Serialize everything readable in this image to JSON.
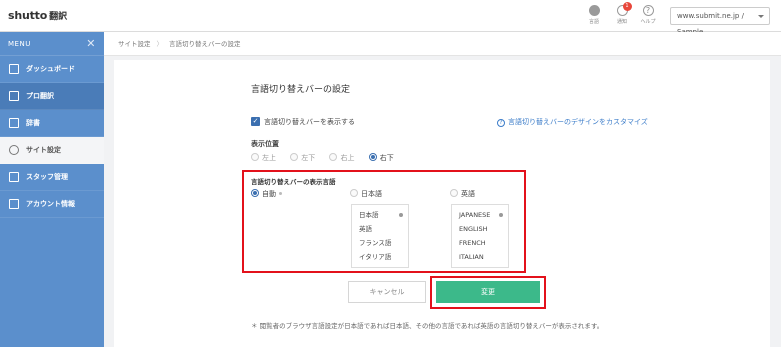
{
  "header": {
    "logo_brand": "shutto",
    "logo_sub": "翻訳",
    "icons": [
      {
        "name": "globe-icon",
        "label": "言語"
      },
      {
        "name": "bell-icon",
        "label": "通知",
        "badge": "1"
      },
      {
        "name": "help-icon",
        "label": "ヘルプ",
        "glyph": "?"
      }
    ],
    "site_select": "www.submit.ne.jp / Sample"
  },
  "sidebar": {
    "menu_label": "MENU",
    "close_glyph": "✕",
    "items": [
      {
        "label": "ダッシュボード",
        "icon": "home-icon"
      },
      {
        "label": "プロ翻訳",
        "icon": "grid-icon"
      },
      {
        "label": "辞書",
        "icon": "book-icon"
      },
      {
        "label": "サイト設定",
        "icon": "gear-icon"
      },
      {
        "label": "スタッフ管理",
        "icon": "users-icon"
      },
      {
        "label": "アカウント情報",
        "icon": "document-icon"
      }
    ]
  },
  "breadcrumb": {
    "parent": "サイト設定",
    "separator": "〉",
    "current": "言語切り替えバーの設定"
  },
  "main": {
    "title": "言語切り替えバーの設定",
    "show_bar_label": "言語切り替えバーを表示する",
    "show_bar_checked": true,
    "customize_link": "言語切り替えバーのデザインをカスタマイズ",
    "position_label": "表示位置",
    "positions": [
      "左上",
      "左下",
      "右上",
      "右下"
    ],
    "position_selected": "右下",
    "display_lang_label": "言語切り替えバーの表示言語",
    "lang_options": [
      {
        "label": "自動",
        "selected": true
      },
      {
        "label": "日本語",
        "selected": false,
        "list": [
          "日本語",
          "英語",
          "フランス語",
          "イタリア語"
        ]
      },
      {
        "label": "英語",
        "selected": false,
        "list": [
          "JAPANESE",
          "ENGLISH",
          "FRENCH",
          "ITALIAN"
        ]
      }
    ],
    "cancel_label": "キャンセル",
    "submit_label": "変更",
    "note": "＊ 閲覧者のブラウザ言語設定が日本語であれば日本語、その他の言語であれば英語の言語切り替えバーが表示されます。"
  },
  "colors": {
    "sidebar": "#5b8fcc",
    "accent_green": "#3cb98a",
    "highlight_red": "#e3111b",
    "link_blue": "#3b7cc9"
  }
}
